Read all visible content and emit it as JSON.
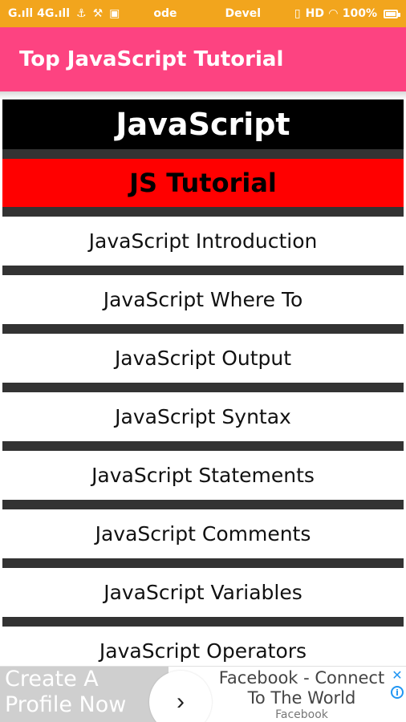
{
  "status_bar": {
    "left_text": "G.ıll 4G.ıll",
    "icons": [
      "usb-icon",
      "tools-icon",
      "nfc-icon"
    ],
    "mode": "ode",
    "carrier": "Devel",
    "right_icons": [
      "vibrate-icon",
      "hd-icon",
      "wifi-icon"
    ],
    "hd": "HD",
    "battery": "100%",
    "background_color": "#f2a51d"
  },
  "app_bar": {
    "title": "Top JavaScript Tutorial",
    "background_color": "#fd4381"
  },
  "sections": {
    "header": "JavaScript",
    "subheader": "JS Tutorial"
  },
  "topics": [
    "JavaScript Introduction",
    "JavaScript Where To",
    "JavaScript Output",
    "JavaScript Syntax",
    "JavaScript Statements",
    "JavaScript Comments",
    "JavaScript Variables",
    "JavaScript Operators"
  ],
  "ad": {
    "left_line1": "Create A",
    "left_line2": "Profile Now",
    "arrow": "›",
    "headline1": "Facebook - Connect",
    "headline2": "To The World",
    "advertiser": "Facebook",
    "info": "i",
    "close": "✕"
  }
}
